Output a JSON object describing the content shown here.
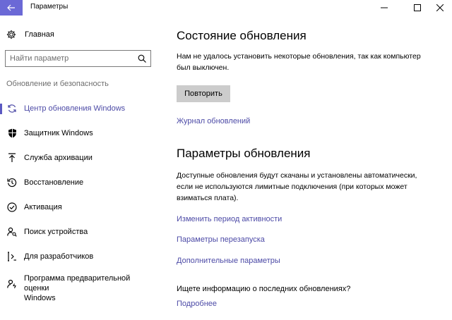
{
  "window": {
    "title": "Параметры"
  },
  "sidebar": {
    "home_label": "Главная",
    "search_placeholder": "Найти параметр",
    "section_title": "Обновление и безопасность",
    "items": [
      {
        "label": "Центр обновления Windows",
        "icon": "sync-icon",
        "active": true
      },
      {
        "label": "Защитник Windows",
        "icon": "shield-icon",
        "active": false
      },
      {
        "label": "Служба архивации",
        "icon": "backup-arrow-icon",
        "active": false
      },
      {
        "label": "Восстановление",
        "icon": "history-icon",
        "active": false
      },
      {
        "label": "Активация",
        "icon": "check-circle-icon",
        "active": false
      },
      {
        "label": "Поиск устройства",
        "icon": "person-search-icon",
        "active": false
      },
      {
        "label": "Для разработчиков",
        "icon": "developer-tools-icon",
        "active": false
      },
      {
        "label": "Программа предварительной оценки",
        "label2": "Windows",
        "icon": "insider-icon",
        "active": false
      }
    ]
  },
  "main": {
    "status_title": "Состояние обновления",
    "status_message_line1": "Нам не удалось установить некоторые обновления, так как компьютер",
    "status_message_line2": "был выключен.",
    "retry_label": "Повторить",
    "history_link": "Журнал обновлений",
    "settings_title": "Параметры обновления",
    "settings_message_line1": "Доступные обновления будут скачаны и установлены автоматически,",
    "settings_message_line2": "если не используются лимитные подключения (при которых может",
    "settings_message_line3": "взиматься плата).",
    "active_hours_link": "Изменить период активности",
    "restart_options_link": "Параметры перезапуска",
    "advanced_options_link": "Дополнительные параметры",
    "info_question": "Ищете информацию о последних обновлениях?",
    "learn_more_link": "Подробнее"
  },
  "colors": {
    "accent": "#6b69d6",
    "link": "#4c4aa6",
    "button_bg": "#cccccc"
  }
}
